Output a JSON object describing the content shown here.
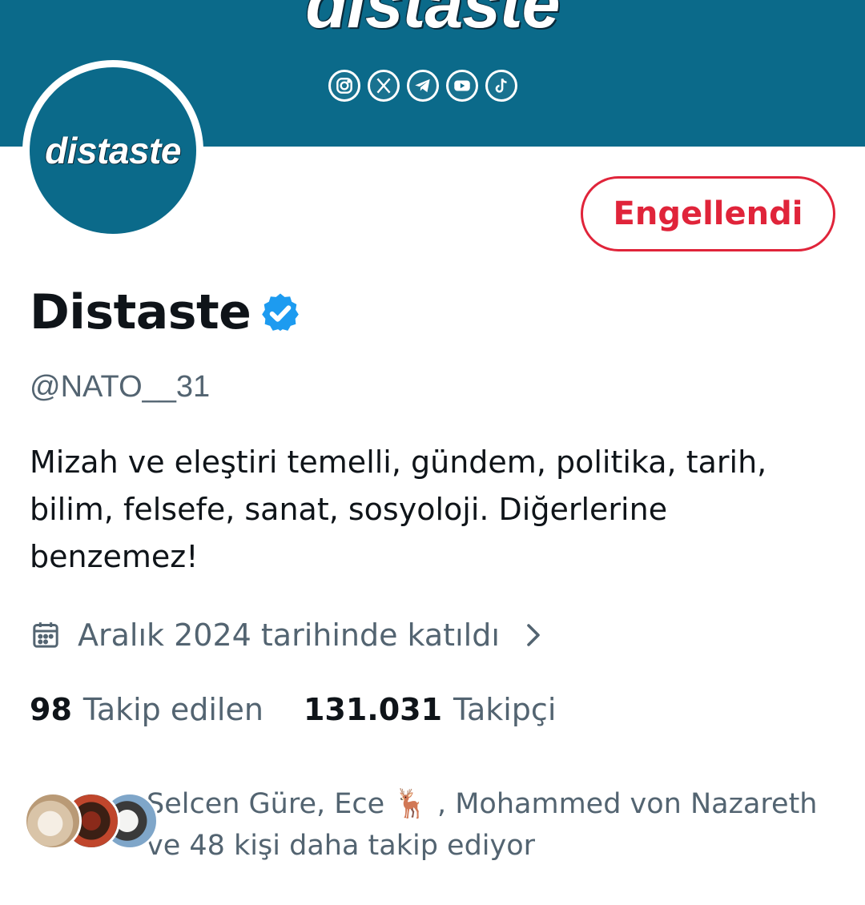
{
  "banner": {
    "title": "distaste",
    "socials": [
      "instagram-icon",
      "x-icon",
      "telegram-icon",
      "youtube-icon",
      "tiktok-icon"
    ]
  },
  "avatar": {
    "text": "distaste"
  },
  "actions": {
    "blocked_label": "Engellendi"
  },
  "profile": {
    "name": "Distaste",
    "handle": "@NATO__31",
    "bio": "Mizah ve eleştiri temelli, gündem, politika, tarih, bilim, felsefe, sanat, sosyoloji. Diğerlerine benzemez!",
    "joined": "Aralık 2024 tarihinde katıldı"
  },
  "stats": {
    "following_count": "98",
    "following_label": "Takip edilen",
    "followers_count": "131.031",
    "followers_label": "Takipçi"
  },
  "followed_by": {
    "line1": "Selcen Güre, Ece 🦌 , Mohammed von Nazareth",
    "line2": "ve 48 kişi daha takip ediyor"
  },
  "colors": {
    "banner": "#0b6a8a",
    "blocked": "#e0243a",
    "verified": "#1d9bf0",
    "secondary_text": "#536471"
  }
}
